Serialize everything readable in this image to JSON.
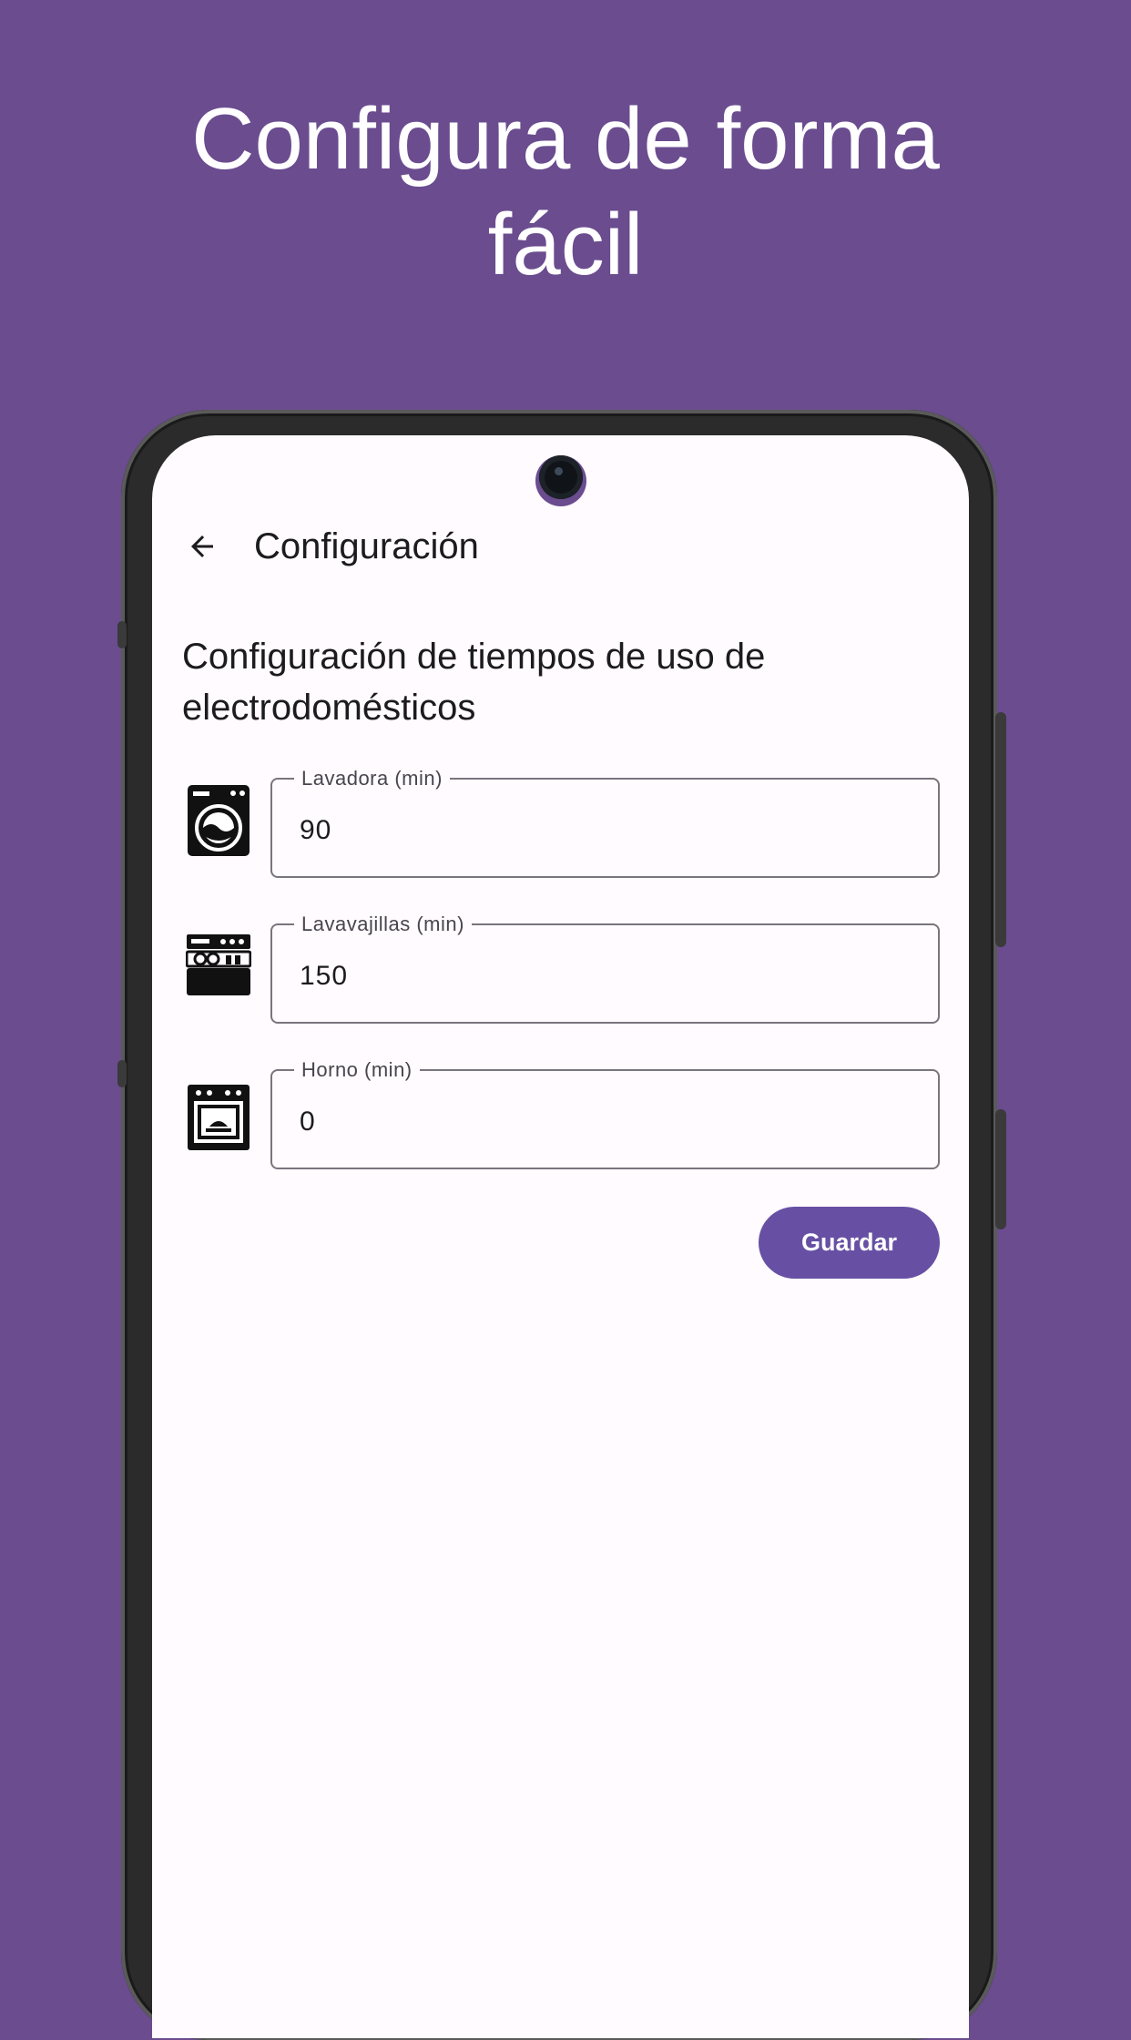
{
  "promo": {
    "title_line1": "Configura de forma",
    "title_line2": "fácil"
  },
  "app_bar": {
    "back_icon": "arrow-back-icon",
    "title": "Configuración"
  },
  "section": {
    "heading": "Configuración de tiempos de uso de electrodomésticos"
  },
  "fields": [
    {
      "icon": "washing-machine-icon",
      "label": "Lavadora (min)",
      "value": "90"
    },
    {
      "icon": "dishwasher-icon",
      "label": "Lavavajillas (min)",
      "value": "150"
    },
    {
      "icon": "oven-icon",
      "label": "Horno (min)",
      "value": "0"
    }
  ],
  "save_button": {
    "label": "Guardar"
  },
  "colors": {
    "background": "#6a4c8f",
    "primary": "#6750a4",
    "surface": "#fffbfe",
    "outline": "#79747e"
  }
}
